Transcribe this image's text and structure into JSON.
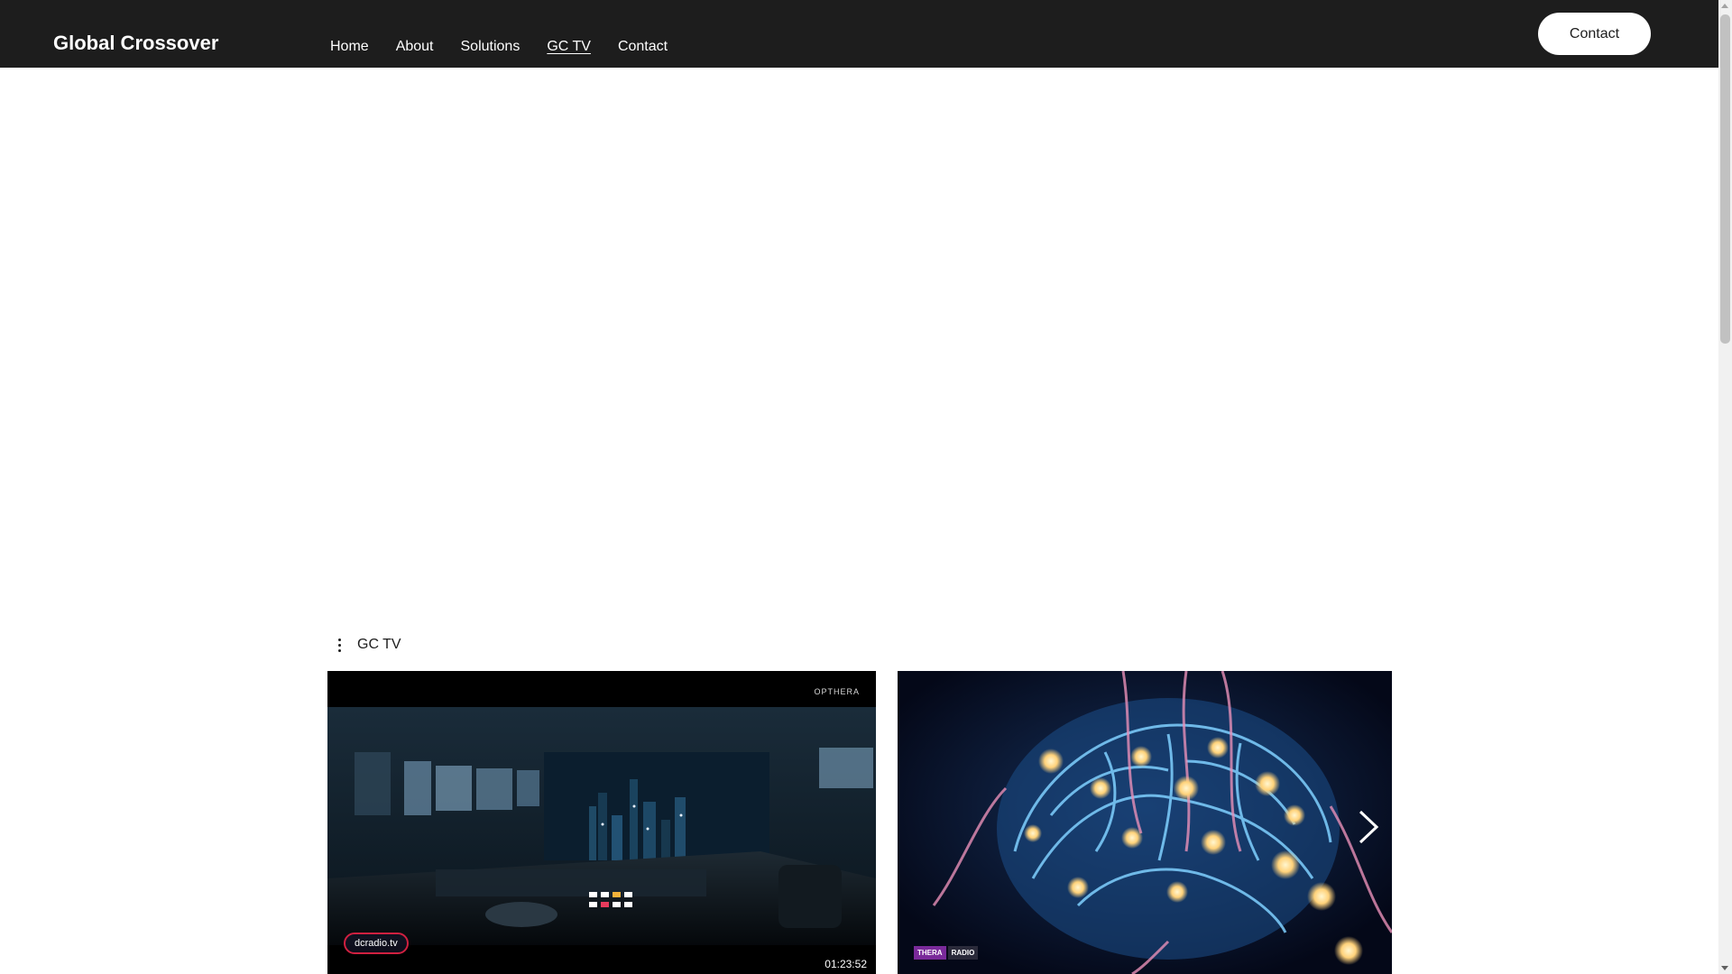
{
  "header": {
    "brand": "Global Crossover",
    "nav": [
      "Home",
      "About",
      "Solutions",
      "GC TV",
      "Contact"
    ],
    "active_nav": "GC TV",
    "contact_button": "Contact",
    "background": "#1d1d1d"
  },
  "channel": {
    "title": "GC TV"
  },
  "videos": [
    {
      "duration": "01:23:52",
      "corner_logo": "OPTHERA",
      "channel_logo": "dcradio.tv"
    },
    {
      "channel_logo_part1": "THERA",
      "channel_logo_part2": "RADIO"
    }
  ],
  "icons": {
    "menu": "kebab-menu-icon",
    "next": "chevron-right-icon"
  }
}
